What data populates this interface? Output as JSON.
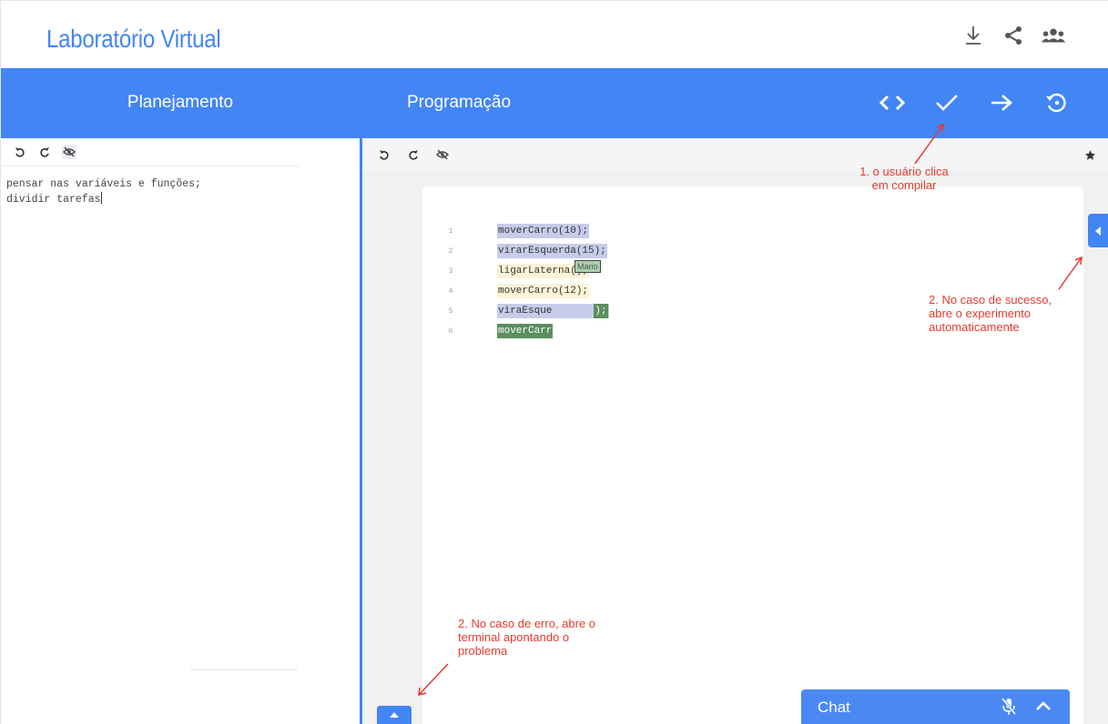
{
  "app": {
    "title": "Laboratório Virtual"
  },
  "top_icons": [
    "download-icon",
    "share-icon",
    "group-icon"
  ],
  "planning": {
    "title": "Planejamento",
    "toolbar": [
      "undo-icon",
      "redo-icon",
      "hide-icon"
    ],
    "text_lines": [
      "pensar nas variáveis e funções;",
      "dividir tarefas"
    ]
  },
  "programming": {
    "title": "Programação",
    "actions": [
      "code-icon",
      "check-icon",
      "arrow-right-icon",
      "restore-icon"
    ],
    "toolbar": [
      "undo-icon",
      "redo-icon",
      "hide-icon",
      "star-icon"
    ],
    "code_lines": [
      {
        "n": "1",
        "text": "moverCarro(10);"
      },
      {
        "n": "2",
        "text": "virarEsquerda(15);"
      },
      {
        "n": "3",
        "text": "ligarLaterna();"
      },
      {
        "n": "4",
        "text": "moverCarro(12);"
      },
      {
        "n": "5",
        "text": "viraEsque",
        "tail": ");"
      },
      {
        "n": "6",
        "text": "moverCarr"
      }
    ],
    "cursor_tag": "Mario"
  },
  "chat": {
    "label": "Chat"
  },
  "annotations": {
    "compile": [
      "1. o usuário clica",
      "em compilar"
    ],
    "success": [
      "2. No caso de sucesso,",
      "abre o experimento",
      "automaticamente"
    ],
    "error": [
      "2. No caso de erro, abre o",
      "terminal apontando o",
      "problema"
    ]
  },
  "colors": {
    "accent": "#4285f4",
    "annotation": "#e33b2e"
  }
}
